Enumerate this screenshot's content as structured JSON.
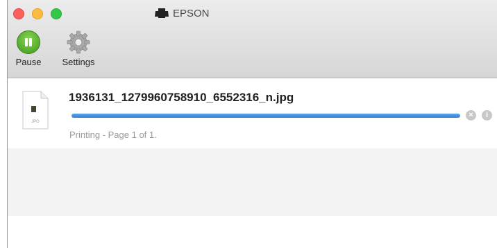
{
  "window": {
    "title": "EPSON"
  },
  "toolbar": {
    "pause_label": "Pause",
    "settings_label": "Settings"
  },
  "job": {
    "file_name": "1936131_1279960758910_6552316_n.jpg",
    "file_type": "JPG",
    "status": "Printing - Page 1 of 1.",
    "progress": 1.0
  },
  "colors": {
    "progress_fill": "#3b8ae0",
    "pause_green": "#5cb536"
  }
}
